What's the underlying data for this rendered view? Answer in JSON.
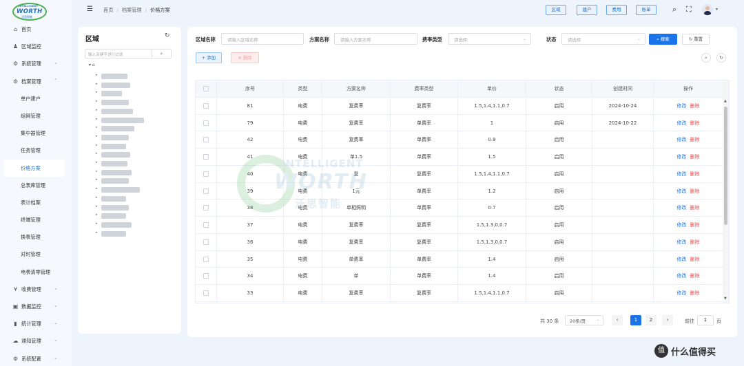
{
  "logo": {
    "small": "INTELLIGENT",
    "big": "WORTH",
    "cn": "沃思智能"
  },
  "sidebar": {
    "items": [
      {
        "label": "首页",
        "icon": "home-icon",
        "glyph": "⌂"
      },
      {
        "label": "区域监控",
        "icon": "user-icon",
        "glyph": "♟"
      },
      {
        "label": "系统管理",
        "icon": "gear-icon",
        "glyph": "⚙",
        "chev": "⌄"
      },
      {
        "label": "档案管理",
        "icon": "gear-icon",
        "glyph": "⚙",
        "chev": "⌃"
      },
      {
        "label": "单户建户",
        "sub": true
      },
      {
        "label": "组网管理",
        "sub": true
      },
      {
        "label": "集中器管理",
        "sub": true
      },
      {
        "label": "任务管理",
        "sub": true
      },
      {
        "label": "价格方案",
        "sub": true,
        "active": true
      },
      {
        "label": "总表库管理",
        "sub": true
      },
      {
        "label": "表计档案",
        "sub": true
      },
      {
        "label": "终端管理",
        "sub": true
      },
      {
        "label": "换表管理",
        "sub": true
      },
      {
        "label": "对时管理",
        "sub": true
      },
      {
        "label": "电表清零管理",
        "sub": true
      },
      {
        "label": "收费管理",
        "icon": "yen-icon",
        "glyph": "¥",
        "chev": "⌄"
      },
      {
        "label": "数据监控",
        "icon": "monitor-icon",
        "glyph": "▣",
        "chev": "⌄"
      },
      {
        "label": "统计管理",
        "icon": "bar-chart-icon",
        "glyph": "▮",
        "chev": "⌄"
      },
      {
        "label": "通知管理",
        "icon": "chat-icon",
        "glyph": "☁",
        "chev": "⌄"
      },
      {
        "label": "系统配置",
        "icon": "gear-icon",
        "glyph": "⚙",
        "chev": "⌄"
      }
    ]
  },
  "header": {
    "menu_toggle": "☰",
    "breadcrumbs": [
      "首页",
      "档案管理",
      "价格方案"
    ],
    "separator": "/",
    "buttons": [
      "区域",
      "建户",
      "费用",
      "账单"
    ],
    "search_glyph": "⌕",
    "fullscreen_glyph": "⛶",
    "caret": "▾"
  },
  "region_panel": {
    "title": "区域",
    "refresh_glyph": "↻",
    "search_placeholder": "输入关键字进行过滤",
    "search_glyph": "⌕",
    "root_glyph": "▾ ⌂",
    "arrow": "▸"
  },
  "filters": {
    "region_label": "区域名称",
    "region_placeholder": "请输入区域名称",
    "scheme_label": "方案名称",
    "scheme_placeholder": "请输入方案名称",
    "rate_label": "费率类型",
    "rate_placeholder": "请选择",
    "status_label": "状态",
    "status_placeholder": "请选择",
    "dropdown_glyph": "⌄",
    "search_button": "⌕ 搜索",
    "reset_button": "↻ 重置",
    "add_button": "+ 添加",
    "delete_button": "⊗ 删除",
    "search_circle": "⌕",
    "refresh_circle": "↻"
  },
  "table": {
    "columns": [
      "",
      "序号",
      "类型",
      "方案名称",
      "费率类型",
      "单价",
      "状态",
      "创建时间",
      "操作"
    ],
    "edit_label": "修改",
    "delete_label": "删除",
    "rows": [
      {
        "no": "81",
        "type": "电费",
        "name": "复费率",
        "rate": "复费率",
        "price": "1.5,1.4,1.1,0.7",
        "status": "启用",
        "created": "2024-10-24"
      },
      {
        "no": "79",
        "type": "电费",
        "name": "复费率",
        "rate": "单费率",
        "price": "1",
        "status": "启用",
        "created": "2024-10-22"
      },
      {
        "no": "42",
        "type": "电费",
        "name": "复费率",
        "rate": "单费率",
        "price": "0.9",
        "status": "启用",
        "created": ""
      },
      {
        "no": "41",
        "type": "电费",
        "name": "单1.5",
        "rate": "单费率",
        "price": "1.5",
        "status": "启用",
        "created": ""
      },
      {
        "no": "40",
        "type": "电费",
        "name": "复",
        "rate": "复费率",
        "price": "1.5,1.4,1.1,0.7",
        "status": "启用",
        "created": ""
      },
      {
        "no": "39",
        "type": "电费",
        "name": "1元",
        "rate": "单费率",
        "price": "1.2",
        "status": "启用",
        "created": ""
      },
      {
        "no": "38",
        "type": "电费",
        "name": "单相照明",
        "rate": "单费率",
        "price": "0.7",
        "status": "启用",
        "created": ""
      },
      {
        "no": "37",
        "type": "电费",
        "name": "复费率",
        "rate": "复费率",
        "price": "1.5,1.3,0,0.7",
        "status": "启用",
        "created": ""
      },
      {
        "no": "36",
        "type": "电费",
        "name": "复费率",
        "rate": "复费率",
        "price": "1.5,1.3,0,0.7",
        "status": "启用",
        "created": ""
      },
      {
        "no": "35",
        "type": "电费",
        "name": "单费率",
        "rate": "单费率",
        "price": "1.4",
        "status": "启用",
        "created": ""
      },
      {
        "no": "34",
        "type": "电费",
        "name": "单",
        "rate": "单费率",
        "price": "1.4",
        "status": "启用",
        "created": ""
      },
      {
        "no": "33",
        "type": "电费",
        "name": "复费率",
        "rate": "复费率",
        "price": "1.5,1.4,1.1,0.7",
        "status": "启用",
        "created": ""
      }
    ],
    "scroll_up": "▲",
    "scroll_down": "▼"
  },
  "watermark": {
    "small": "INTELLIGENT",
    "big": "WORTH",
    "cn": "沃思智能"
  },
  "pagination": {
    "total": "共 30 条",
    "page_size": "20条/页",
    "prev": "‹",
    "next": "›",
    "pages": [
      "1",
      "2"
    ],
    "current_page": 1,
    "jump_prefix": "前往",
    "jump_value": "1",
    "jump_suffix": "页"
  },
  "corner": {
    "badge": "值",
    "text": "什么值得买"
  },
  "colors": {
    "primary": "#1a73e8",
    "danger": "#f04848",
    "logo_green": "#4caf50"
  }
}
